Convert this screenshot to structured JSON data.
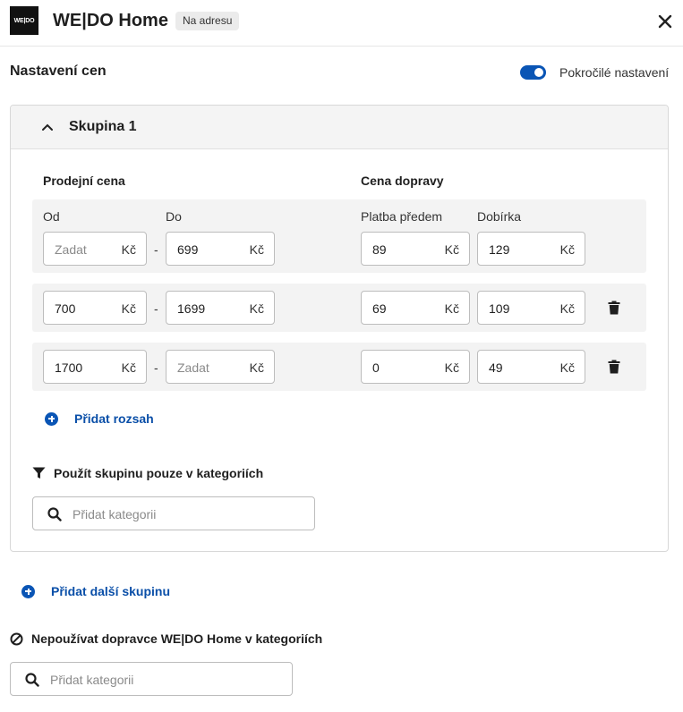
{
  "header": {
    "logo_text": "WE|DO",
    "title": "WE|DO Home",
    "badge": "Na adresu",
    "close_icon": "close-icon"
  },
  "settings": {
    "title": "Nastavení cen",
    "advanced_label": "Pokročilé nastavení",
    "advanced_on": true
  },
  "group": {
    "title": "Skupina 1",
    "expanded": true,
    "price_title": "Prodejní cena",
    "shipping_title": "Cena dopravy",
    "from_label": "Od",
    "to_label": "Do",
    "prepaid_label": "Platba předem",
    "cod_label": "Dobírka",
    "currency": "Kč",
    "dash": "-",
    "rows": [
      {
        "from": "",
        "from_placeholder": "Zadat",
        "to": "699",
        "to_placeholder": "",
        "prepaid": "89",
        "cod": "129"
      },
      {
        "from": "700",
        "from_placeholder": "",
        "to": "1699",
        "to_placeholder": "",
        "prepaid": "69",
        "cod": "109"
      },
      {
        "from": "1700",
        "from_placeholder": "",
        "to": "",
        "to_placeholder": "Zadat",
        "prepaid": "0",
        "cod": "49"
      }
    ],
    "add_range_label": "Přidat rozsah",
    "category_filter_label": "Použít skupinu pouze v kategoriích",
    "category_placeholder": "Přidat kategorii"
  },
  "add_group_label": "Přidat další skupinu",
  "exclude": {
    "label": "Nepoužívat dopravce WE|DO Home v kategoriích",
    "placeholder": "Přidat kategorii"
  },
  "colors": {
    "accent": "#0a55b5",
    "link": "#0a4fa8",
    "row_bg": "#f3f3f3"
  }
}
